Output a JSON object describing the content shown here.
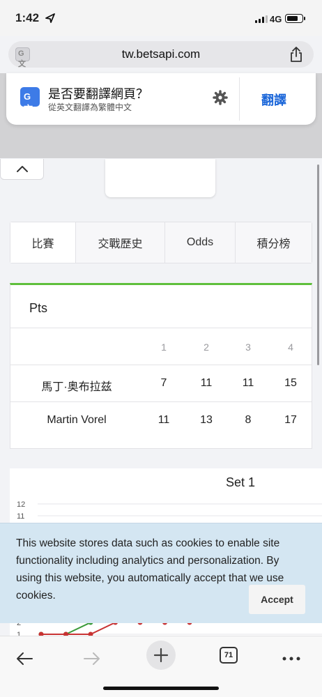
{
  "status_bar": {
    "time": "1:42",
    "network": "4G"
  },
  "address_bar": {
    "url": "tw.betsapi.com"
  },
  "translate_banner": {
    "title": "是否要翻譯網頁？",
    "subtitle": "從英文翻譯為繁體中文",
    "action_label": "翻譯"
  },
  "tabs": [
    {
      "label": "比賽",
      "active": true
    },
    {
      "label": "交戰歷史",
      "active": false
    },
    {
      "label": "Odds",
      "active": false
    },
    {
      "label": "積分榜",
      "active": false
    }
  ],
  "pts_table": {
    "title": "Pts",
    "columns": [
      "1",
      "2",
      "3",
      "4"
    ],
    "rows": [
      {
        "name": "馬丁·奥布拉兹",
        "scores": [
          "7",
          "11",
          "11",
          "15"
        ]
      },
      {
        "name": "Martin Vorel",
        "scores": [
          "11",
          "13",
          "8",
          "17"
        ]
      }
    ]
  },
  "chart_data": {
    "type": "line",
    "title": "Set 1",
    "y_visible_ticks": [
      "12",
      "11",
      "2",
      "1"
    ],
    "ylim": [
      0,
      12
    ],
    "series": [
      {
        "color": "#3a9a3a",
        "values": [
          1,
          1,
          2,
          3
        ]
      },
      {
        "color": "#c83232",
        "values": [
          1,
          1,
          1,
          2,
          2,
          2,
          2
        ]
      }
    ]
  },
  "cookie_notice": {
    "message": "This website stores data such as cookies to enable site functionality including analytics and personalization. By using this website, you automatically accept that we use cookies.",
    "accept_label": "Accept"
  },
  "toolbar": {
    "tab_count": "71"
  }
}
